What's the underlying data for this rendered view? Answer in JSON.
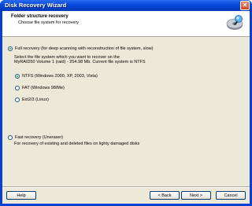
{
  "window": {
    "title": "Disk Recovery Wizard",
    "close_label": "✕"
  },
  "header": {
    "title": "Folder structure recovery",
    "subtitle": "Choose file system for recovery",
    "icon": "disk-drive-icon"
  },
  "options": {
    "full": {
      "label": "Full recovery (for deep scanning with reconstruction of file system, slow)",
      "selected": true,
      "description_line1": "Select the file system which you want to recover on the",
      "description_line2": "MyRAID50 Volume 1 (raid) - 254.98 Mb. Current file system is NTFS"
    },
    "filesystems": [
      {
        "label": "NTFS (Windows 2000, XP, 2003, Vista)",
        "selected": true
      },
      {
        "label": "FAT (Windows 98/Me)",
        "selected": false
      },
      {
        "label": "Ext2/3 (Linux)",
        "selected": false
      }
    ],
    "fast": {
      "label": "Fast recovery (Uneraser)",
      "selected": false,
      "description": "For recovery of existing and deleted files on lighty damaged disks"
    }
  },
  "buttons": {
    "help": "Help",
    "back": "< Back",
    "next": "Next >",
    "cancel": "Cancel"
  },
  "colors": {
    "titlebar": "#0548d8",
    "dialog_bg": "#ece9d8",
    "radio_checked": "#21a121"
  }
}
